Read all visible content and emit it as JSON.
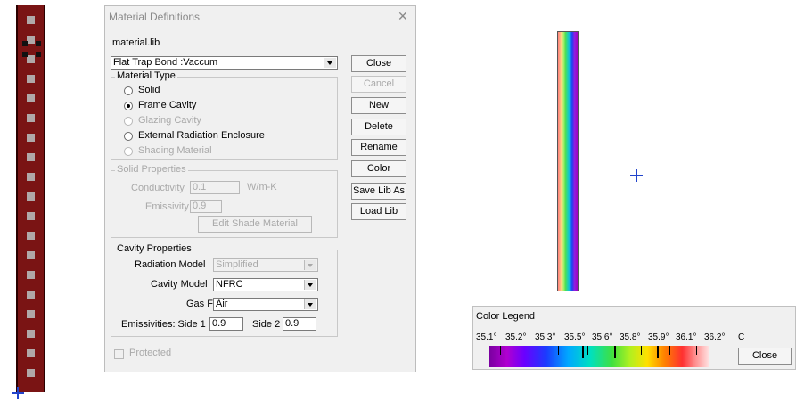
{
  "dialog": {
    "title": "Material Definitions",
    "close_glyph": "✕",
    "library_file": "material.lib",
    "material_selected": "Flat Trap Bond :Vaccum",
    "material_type": {
      "title": "Material Type",
      "options": [
        {
          "label": "Solid",
          "enabled": true,
          "selected": false
        },
        {
          "label": "Frame Cavity",
          "enabled": true,
          "selected": true
        },
        {
          "label": "Glazing Cavity",
          "enabled": false,
          "selected": false
        },
        {
          "label": "External Radiation Enclosure",
          "enabled": true,
          "selected": false
        },
        {
          "label": "Shading Material",
          "enabled": false,
          "selected": false
        }
      ]
    },
    "solid_properties": {
      "title": "Solid Properties",
      "conductivity_label": "Conductivity",
      "conductivity_value": "0.1",
      "conductivity_unit": "W/m-K",
      "emissivity_label": "Emissivity",
      "emissivity_value": "0.9",
      "edit_shade_label": "Edit Shade Material"
    },
    "cavity_properties": {
      "title": "Cavity Properties",
      "radiation_model_label": "Radiation Model",
      "radiation_model_value": "Simplified",
      "cavity_model_label": "Cavity Model",
      "cavity_model_value": "NFRC",
      "gas_fill_label": "Gas Fill",
      "gas_fill_value": "Air",
      "emissivities_label": "Emissivities: Side 1",
      "side1_value": "0.9",
      "side2_label": "Side 2",
      "side2_value": "0.9"
    },
    "protected_label": "Protected",
    "buttons": {
      "close": "Close",
      "cancel": "Cancel",
      "new": "New",
      "delete": "Delete",
      "rename": "Rename",
      "color": "Color",
      "save_lib_as": "Save Lib As",
      "load_lib": "Load Lib"
    }
  },
  "legend": {
    "title": "Color Legend",
    "ticks": [
      "35.1°",
      "35.2°",
      "35.3°",
      "35.5°",
      "35.6°",
      "35.8°",
      "35.9°",
      "36.1°",
      "36.2°"
    ],
    "unit": "C",
    "close_label": "Close"
  },
  "colors": {
    "frame_strip": "#7a1414",
    "crosshair": "#2244cc"
  },
  "icons": [
    "crosshair-icon",
    "close-icon",
    "chevron-down-icon"
  ]
}
